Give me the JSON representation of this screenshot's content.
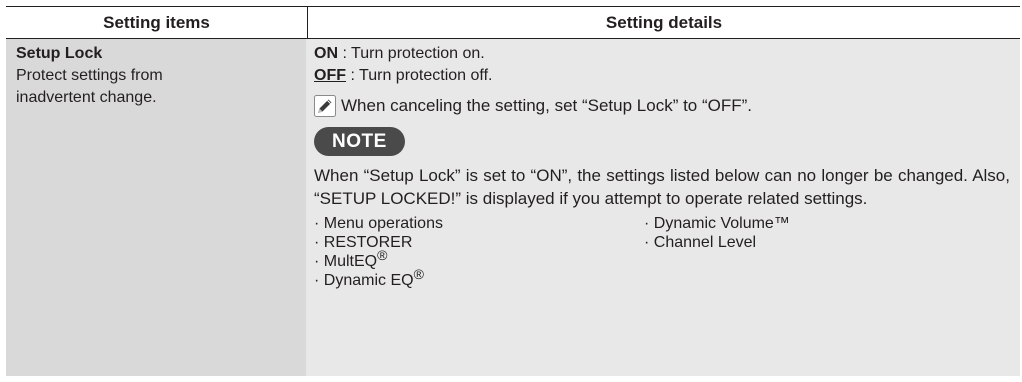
{
  "table": {
    "header": {
      "items": "Setting items",
      "details": "Setting details"
    },
    "row": {
      "title": "Setup Lock",
      "description": "Protect settings from inadvertent change.",
      "options": [
        {
          "key": "ON",
          "text": " : Turn protection on."
        },
        {
          "key": "OFF",
          "text": " : Turn protection off."
        }
      ],
      "hint": "When canceling the setting, set “Setup Lock” to “OFF”.",
      "note_label": "NOTE",
      "note_text": "When “Setup Lock” is set to “ON”, the settings listed below can no longer be changed. Also, “SETUP LOCKED!” is displayed if you attempt to operate related settings.",
      "list_col1": [
        "· Menu operations",
        "· RESTORER",
        "· MultEQ",
        "· Dynamic EQ"
      ],
      "list_col2": [
        "· Dynamic Volume™",
        "· Channel Level"
      ],
      "reg_mark": "®"
    }
  },
  "icons": {
    "hint_icon": "pencil-icon"
  }
}
